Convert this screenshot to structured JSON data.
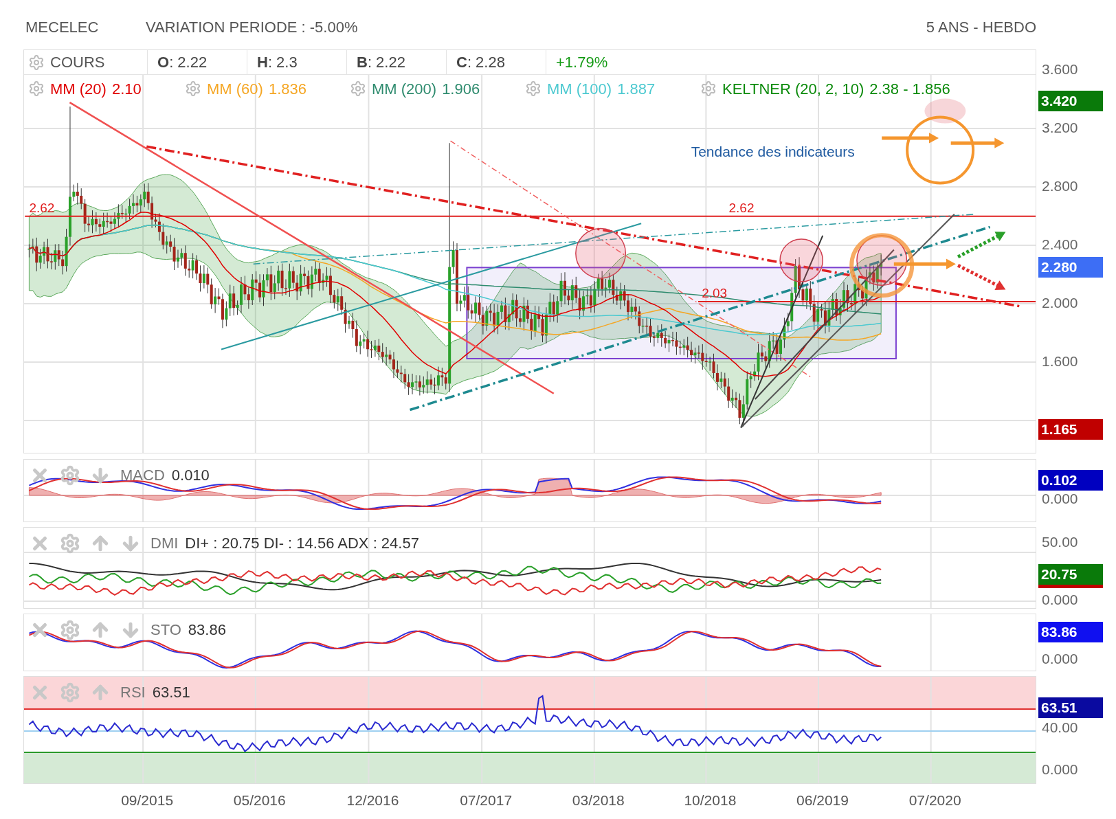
{
  "header": {
    "symbol": "MECELEC",
    "variation": "VARIATION PERIODE : -5.00%",
    "period": "5 ANS - HEBDO"
  },
  "price_legend": {
    "label": "COURS",
    "fields": [
      "**O**: 2.22",
      "**H**: 2.3",
      "**B**: 2.22",
      "**C**: 2.28"
    ],
    "change": "+1.79%"
  },
  "overlays": [
    {
      "label": "MM (20)",
      "value": "2.10",
      "color": "#e00000"
    },
    {
      "label": "MM (60)",
      "value": "1.836",
      "color": "#f5a623"
    },
    {
      "label": "MM (200)",
      "value": "1.906",
      "color": "#2e8b6e"
    },
    {
      "label": "MM (100)",
      "value": "1.887",
      "color": "#4cc9d0"
    },
    {
      "label": "KELTNER (20, 2, 10)",
      "value": "2.38 - 1.856",
      "color": "#0a8a0a"
    }
  ],
  "main_chart": {
    "level_labels": [
      "2.62",
      "2.62",
      "2.03"
    ],
    "annotation": "Tendance des indicateurs",
    "y_axis": [
      "3.600",
      "3.200",
      "2.800",
      "2.400",
      "2.000",
      "1.600"
    ],
    "badges": [
      {
        "text": "3.420",
        "color": "#0a7a0a"
      },
      {
        "text": "2.280",
        "color": "#3d6ef5"
      },
      {
        "text": "1.165",
        "color": "#c00000"
      }
    ]
  },
  "indicators": [
    {
      "kind": "macd",
      "label": "MACD",
      "reading": "0.010",
      "move_up": false,
      "move_down": true,
      "axis": [
        "0.000"
      ],
      "badges": [
        {
          "text": "0.102",
          "color": "#0000c0"
        }
      ]
    },
    {
      "kind": "dmi",
      "label": "DMI",
      "reading": "DI+ : 20.75 DI- : 14.56 ADX : 24.57",
      "move_up": true,
      "move_down": true,
      "axis": [
        "50.00",
        "0.000"
      ],
      "badges": [
        {
          "text": "20.75",
          "color": "#0a7a0a"
        }
      ]
    },
    {
      "kind": "sto",
      "label": "STO",
      "reading": "83.86",
      "move_up": true,
      "move_down": true,
      "axis": [
        "0.000"
      ],
      "badges": [
        {
          "text": "83.86",
          "color": "#1010f0"
        }
      ]
    },
    {
      "kind": "rsi",
      "label": "RSI",
      "reading": "63.51",
      "move_up": true,
      "move_down": false,
      "axis": [
        "40.00",
        "0.000"
      ],
      "badges": [
        {
          "text": "63.51",
          "color": "#0a0aa0"
        }
      ]
    }
  ],
  "x_axis": [
    "09/2015",
    "05/2016",
    "12/2016",
    "07/2017",
    "03/2018",
    "10/2018",
    "06/2019",
    "07/2020"
  ]
}
